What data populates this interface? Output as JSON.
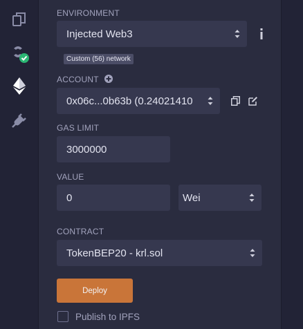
{
  "sidebar": {
    "icons": [
      "file-explorer-icon",
      "compiler-icon",
      "deploy-run-icon",
      "plugin-manager-icon"
    ],
    "accent": "#2bb673"
  },
  "environment": {
    "label": "ENVIRONMENT",
    "selected": "Injected Web3",
    "network_badge": "Custom (56) network"
  },
  "account": {
    "label": "ACCOUNT",
    "selected": "0x06c...0b63b (0.24021410"
  },
  "gas_limit": {
    "label": "GAS LIMIT",
    "value": "3000000"
  },
  "value": {
    "label": "VALUE",
    "amount": "0",
    "unit": "Wei"
  },
  "contract": {
    "label": "CONTRACT",
    "selected": "TokenBEP20 - krl.sol"
  },
  "deploy": {
    "label": "Deploy",
    "color": "#c97539"
  },
  "publish": {
    "label": "Publish to IPFS",
    "checked": false
  }
}
